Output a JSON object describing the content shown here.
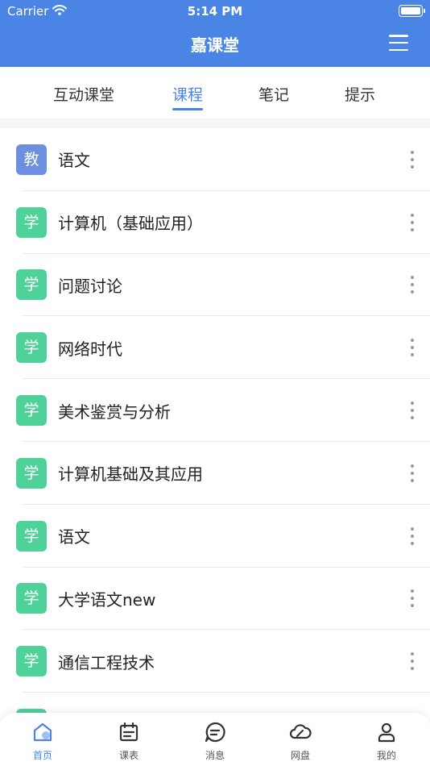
{
  "status_bar": {
    "carrier": "Carrier",
    "time": "5:14 PM"
  },
  "header": {
    "title": "嘉课堂"
  },
  "tabs": [
    {
      "label": "互动课堂",
      "active": false
    },
    {
      "label": "课程",
      "active": true
    },
    {
      "label": "笔记",
      "active": false
    },
    {
      "label": "提示",
      "active": false
    }
  ],
  "courses": [
    {
      "badge": "教",
      "name": "语文"
    },
    {
      "badge": "学",
      "name": "计算机（基础应用）"
    },
    {
      "badge": "学",
      "name": "问题讨论"
    },
    {
      "badge": "学",
      "name": "网络时代"
    },
    {
      "badge": "学",
      "name": "美术鉴赏与分析"
    },
    {
      "badge": "学",
      "name": "计算机基础及其应用"
    },
    {
      "badge": "学",
      "name": "语文"
    },
    {
      "badge": "学",
      "name": "大学语文new"
    },
    {
      "badge": "学",
      "name": "通信工程技术"
    }
  ],
  "bottom_nav": [
    {
      "label": "首页",
      "icon": "home-icon",
      "active": true
    },
    {
      "label": "课表",
      "icon": "calendar-icon",
      "active": false
    },
    {
      "label": "消息",
      "icon": "message-icon",
      "active": false
    },
    {
      "label": "网盘",
      "icon": "cloud-icon",
      "active": false
    },
    {
      "label": "我的",
      "icon": "user-icon",
      "active": false
    }
  ],
  "colors": {
    "primary": "#4a85e6",
    "teacher_badge": "#6c8fe0",
    "student_badge": "#4fd19a"
  }
}
